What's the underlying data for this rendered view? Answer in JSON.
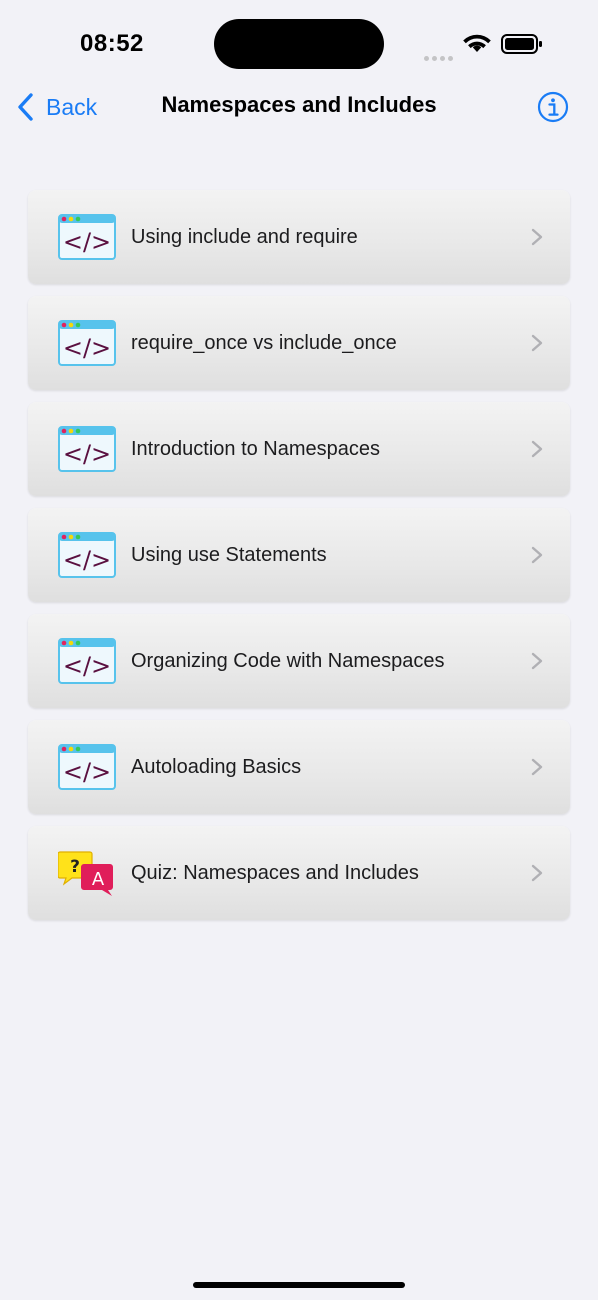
{
  "status_bar": {
    "time": "08:52"
  },
  "nav": {
    "back_label": "Back",
    "title": "Namespaces and Includes"
  },
  "colors": {
    "accent": "#1a7cf5",
    "background": "#f2f2f7",
    "code_icon_frame": "#57c3ec",
    "code_icon_glyph": "#5a1040"
  },
  "items": [
    {
      "label": "Using include and require",
      "icon": "code-window-icon"
    },
    {
      "label": "require_once vs include_once",
      "icon": "code-window-icon"
    },
    {
      "label": "Introduction to Namespaces",
      "icon": "code-window-icon"
    },
    {
      "label": "Using use Statements",
      "icon": "code-window-icon"
    },
    {
      "label": "Organizing Code with Namespaces",
      "icon": "code-window-icon"
    },
    {
      "label": "Autoloading Basics",
      "icon": "code-window-icon"
    },
    {
      "label": "Quiz: Namespaces and Includes",
      "icon": "quiz-speech-bubbles-icon"
    }
  ]
}
